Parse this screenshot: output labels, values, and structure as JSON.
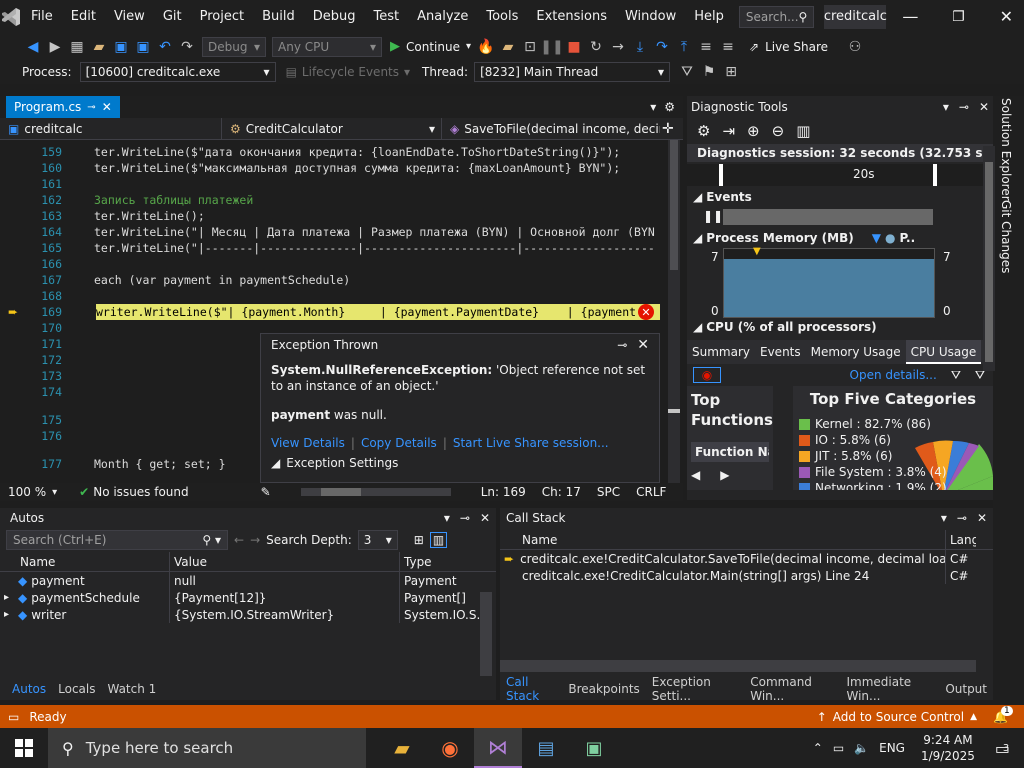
{
  "menu": {
    "items": [
      "File",
      "Edit",
      "View",
      "Git",
      "Project",
      "Build",
      "Debug",
      "Test",
      "Analyze",
      "Tools",
      "Extensions",
      "Window",
      "Help"
    ],
    "search_placeholder": "Search...",
    "solution_name": "creditcalc"
  },
  "toolbar": {
    "config": "Debug",
    "platform": "Any CPU",
    "continue_label": "Continue",
    "live_share": "Live Share"
  },
  "process_bar": {
    "process_label": "Process:",
    "process_value": "[10600] creditcalc.exe",
    "lifecycle_label": "Lifecycle Events",
    "thread_label": "Thread:",
    "thread_value": "[8232] Main Thread"
  },
  "document": {
    "tab_label": "Program.cs",
    "nav_project": "creditcalc",
    "nav_class": "CreditCalculator",
    "nav_member": "SaveToFile(decimal income, decim"
  },
  "code_lines": [
    {
      "num": "159",
      "text": "ter.WriteLine($\"дата окончания кредита: {loanEndDate.ToShortDateString()}\");"
    },
    {
      "num": "160",
      "text": "ter.WriteLine($\"максимальная доступная сумма кредита: {maxLoanAmount} BYN\");"
    },
    {
      "num": "161",
      "text": ""
    },
    {
      "num": "162",
      "text": "Запись таблицы платежей"
    },
    {
      "num": "163",
      "text": "ter.WriteLine();"
    },
    {
      "num": "164",
      "text": "ter.WriteLine(\"| Месяц | Дата платежа | Размер платежа (BYN) | Основной долг (BYN"
    },
    {
      "num": "165",
      "text": "ter.WriteLine(\"|-------|--------------|----------------------|-------------------"
    },
    {
      "num": "166",
      "text": ""
    },
    {
      "num": "167",
      "text": "each (var payment in paymentSchedule)"
    },
    {
      "num": "168",
      "text": ""
    },
    {
      "num": "169",
      "text": "writer.WriteLine($\"| {payment.Month}     | {payment.PaymentDate}    | {payment"
    },
    {
      "num": "170",
      "text": ""
    },
    {
      "num": "171",
      "text": ""
    },
    {
      "num": "172",
      "text": ""
    },
    {
      "num": "173",
      "text": ""
    },
    {
      "num": "174",
      "text": ""
    },
    {
      "num": "175",
      "text": ""
    },
    {
      "num": "176",
      "text": ""
    },
    {
      "num": "177",
      "text": "Month { get; set; }"
    }
  ],
  "exception": {
    "title": "Exception Thrown",
    "type": "System.NullReferenceException:",
    "message": "'Object reference not set to an instance of an object.'",
    "var_name": "payment",
    "var_msg": " was null.",
    "link_view": "View Details",
    "link_copy": "Copy Details",
    "link_live": "Start Live Share session...",
    "settings": "Exception Settings"
  },
  "editor_status": {
    "zoom": "100 %",
    "issues": "No issues found",
    "ln": "Ln: 169",
    "ch": "Ch: 17",
    "spc": "SPC",
    "crlf": "CRLF"
  },
  "diag": {
    "title": "Diagnostic Tools",
    "session": "Diagnostics session: 32 seconds (32.753 s selected)",
    "timeline_label": "20s",
    "events_label": "Events",
    "memory_label": "Process Memory (MB)",
    "memory_legend": "P..",
    "mem_max": "7",
    "mem_min": "0",
    "cpu_label": "CPU (% of all processors)",
    "tabs": [
      "Summary",
      "Events",
      "Memory Usage",
      "CPU Usage"
    ],
    "open_details": "Open details...",
    "top_functions": "Top Functions",
    "function_name": "Function Nan",
    "top_five": "Top Five Categories",
    "categories": [
      {
        "label": "Kernel : 82.7% (86)",
        "color": "#6abf4b"
      },
      {
        "label": "IO : 5.8% (6)",
        "color": "#e05a1a"
      },
      {
        "label": "JIT : 5.8% (6)",
        "color": "#f5a623"
      },
      {
        "label": "File System : 3.8% (4)",
        "color": "#9b59b6"
      },
      {
        "label": "Networking : 1.9% (2)",
        "color": "#3b7dd8"
      }
    ]
  },
  "right_sidebar": [
    "Solution Explorer",
    "Git Changes"
  ],
  "autos": {
    "title": "Autos",
    "search_placeholder": "Search (Ctrl+E)",
    "depth_label": "Search Depth:",
    "depth_value": "3",
    "headers": [
      "Name",
      "Value",
      "Type"
    ],
    "rows": [
      {
        "name": "payment",
        "value": "null",
        "type": "Payment",
        "expand": ""
      },
      {
        "name": "paymentSchedule",
        "value": "{Payment[12]}",
        "type": "Payment[]",
        "expand": "▸"
      },
      {
        "name": "writer",
        "value": "{System.IO.StreamWriter}",
        "type": "System.IO.S...",
        "expand": "▸"
      }
    ],
    "tabs": [
      "Autos",
      "Locals",
      "Watch 1"
    ]
  },
  "callstack": {
    "title": "Call Stack",
    "headers": [
      "Name",
      "Lang"
    ],
    "rows": [
      {
        "name": "creditcalc.exe!CreditCalculator.SaveToFile(decimal income, decimal loanPaym...",
        "lang": "C#"
      },
      {
        "name": "creditcalc.exe!CreditCalculator.Main(string[] args) Line 24",
        "lang": "C#"
      }
    ],
    "tabs": [
      "Call Stack",
      "Breakpoints",
      "Exception Setti...",
      "Command Win...",
      "Immediate Win...",
      "Output"
    ]
  },
  "status": {
    "ready": "Ready",
    "source_control": "Add to Source Control",
    "notifications": "1"
  },
  "taskbar": {
    "search_placeholder": "Type here to search",
    "lang": "ENG",
    "time": "9:24 AM",
    "date": "1/9/2025",
    "notif_count": "3"
  },
  "colors": {
    "accent": "#007acc",
    "status_bar": "#ca5100",
    "highlight_line": "#e6e66e",
    "exception_red": "#e51400"
  }
}
